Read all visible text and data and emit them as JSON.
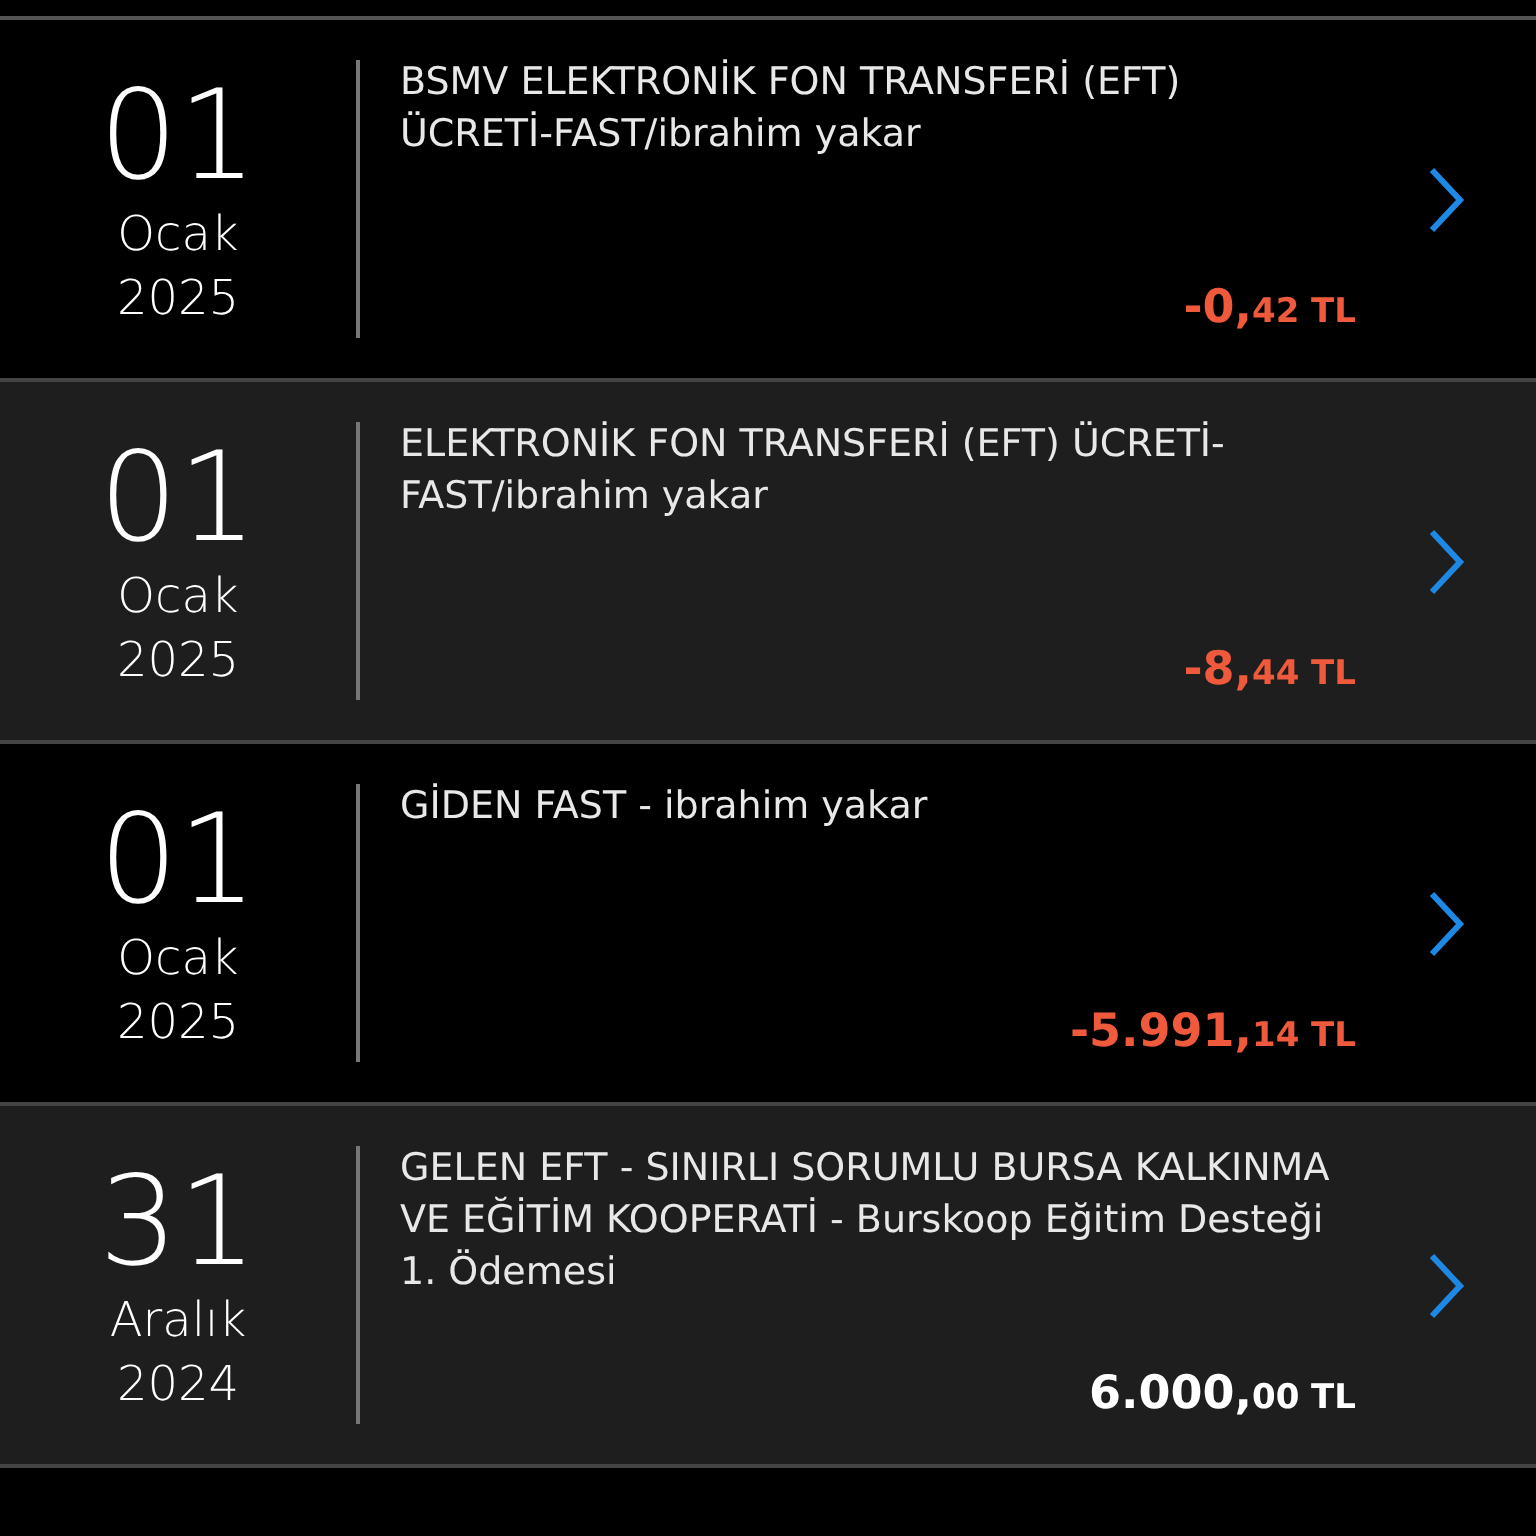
{
  "transactions": [
    {
      "day": "01",
      "month": "Ocak",
      "year": "2025",
      "description": "BSMV ELEKTRONİK FON TRANSFERİ (EFT) ÜCRETİ-FAST/ibrahim yakar",
      "amount_whole": "-0,",
      "amount_rest": "42 TL",
      "kind": "debit"
    },
    {
      "day": "01",
      "month": "Ocak",
      "year": "2025",
      "description": "ELEKTRONİK FON TRANSFERİ (EFT) ÜCRETİ-FAST/ibrahim yakar",
      "amount_whole": "-8,",
      "amount_rest": "44 TL",
      "kind": "debit"
    },
    {
      "day": "01",
      "month": "Ocak",
      "year": "2025",
      "description": "GİDEN FAST - ibrahim yakar",
      "amount_whole": "-5.991,",
      "amount_rest": "14 TL",
      "kind": "debit"
    },
    {
      "day": "31",
      "month": "Aralık",
      "year": "2024",
      "description": "GELEN EFT - SINIRLI SORUMLU BURSA KALKINMA VE EĞİTİM KOOPERATİ - Burskoop Eğitim Desteği 1. Ödemesi",
      "amount_whole": "6.000,",
      "amount_rest": "00 TL",
      "kind": "credit"
    }
  ]
}
